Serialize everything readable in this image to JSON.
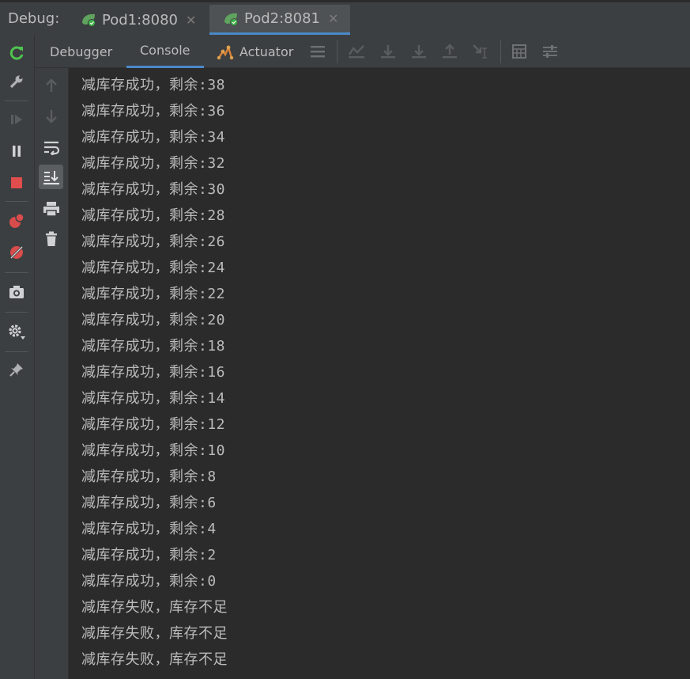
{
  "header": {
    "debug_label": "Debug:",
    "tabs": [
      {
        "label": "Pod1:8080",
        "active": false
      },
      {
        "label": "Pod2:8081",
        "active": true
      }
    ]
  },
  "toolbar": {
    "tabs": [
      {
        "label": "Debugger",
        "active": false
      },
      {
        "label": "Console",
        "active": true
      },
      {
        "label": "Actuator",
        "active": false
      }
    ]
  },
  "colors": {
    "background": "#2b2b2b",
    "panel": "#3c3f41",
    "accent": "#4a88c7",
    "text": "#bbbbbb",
    "rerun_green": "#4fc44f",
    "stop_red": "#e04d4d"
  },
  "console": {
    "lines": [
      "减库存成功，剩余:38",
      "减库存成功，剩余:36",
      "减库存成功，剩余:34",
      "减库存成功，剩余:32",
      "减库存成功，剩余:30",
      "减库存成功，剩余:28",
      "减库存成功，剩余:26",
      "减库存成功，剩余:24",
      "减库存成功，剩余:22",
      "减库存成功，剩余:20",
      "减库存成功，剩余:18",
      "减库存成功，剩余:16",
      "减库存成功，剩余:14",
      "减库存成功，剩余:12",
      "减库存成功，剩余:10",
      "减库存成功，剩余:8",
      "减库存成功，剩余:6",
      "减库存成功，剩余:4",
      "减库存成功，剩余:2",
      "减库存成功，剩余:0",
      "减库存失败，库存不足",
      "减库存失败，库存不足",
      "减库存失败，库存不足"
    ]
  }
}
